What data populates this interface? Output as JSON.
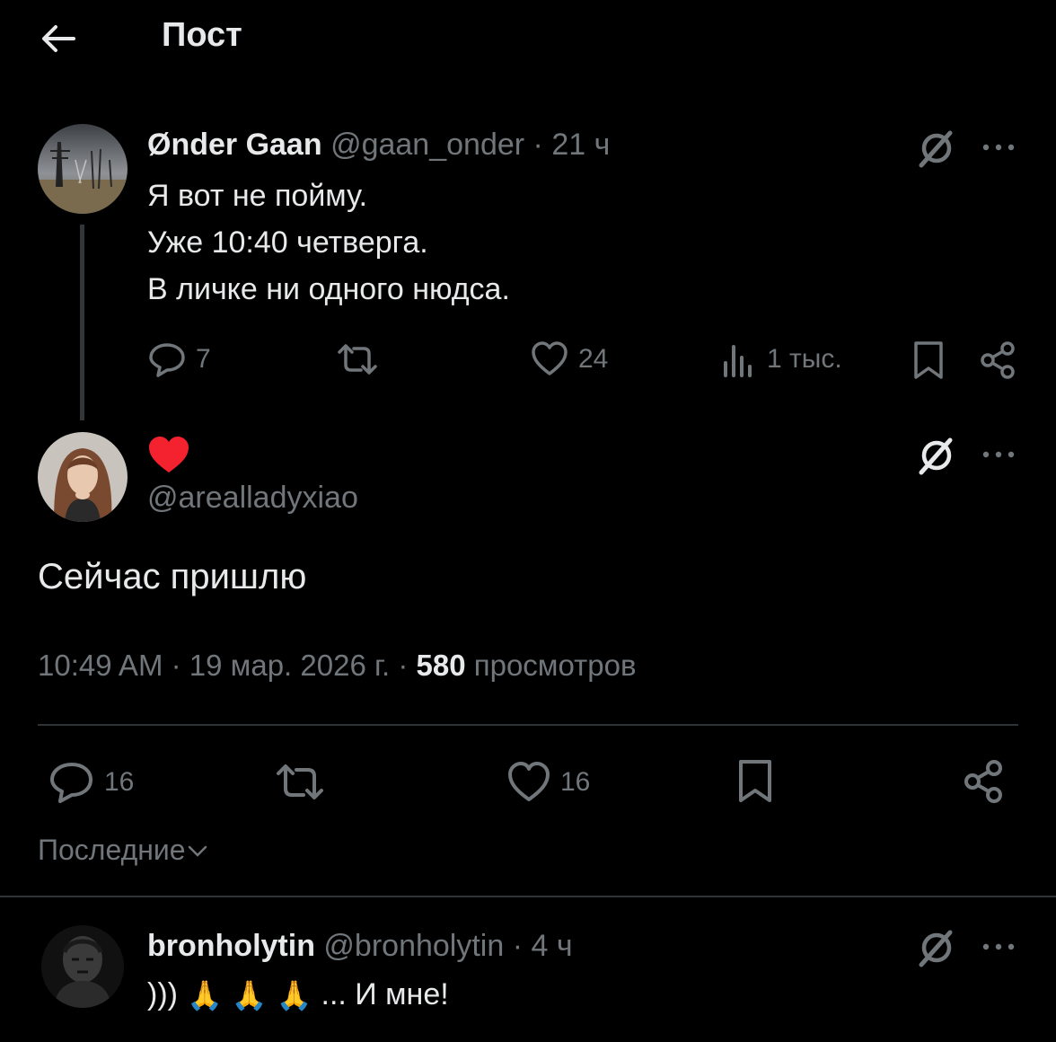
{
  "header": {
    "title": "Пост",
    "back_icon": "arrow-left-icon"
  },
  "parent_post": {
    "author_name": "Ønder Gaan",
    "handle": "@gaan_onder",
    "separator": "·",
    "time": "21 ч",
    "lines": [
      "Я вот не пойму.",
      "Уже 10:40 четверга.",
      "В личке ни одного нюдса."
    ],
    "replies": "7",
    "likes": "24",
    "views": "1 тыс."
  },
  "main_post": {
    "display_name_icon": "red-heart-icon",
    "handle": "@arealladyxiao",
    "text": "Сейчас пришлю",
    "time": "10:49 AM",
    "date": "19 мар. 2026 г.",
    "separator": "·",
    "views_count": "580",
    "views_label": "просмотров",
    "replies": "16",
    "likes": "16"
  },
  "sort": {
    "label": "Последние"
  },
  "reply": {
    "author_name": "bronholytin",
    "handle": "@bronholytin",
    "separator": "·",
    "time": "4 ч",
    "text_start": ")))",
    "emojis": [
      "🙏",
      "🙏",
      "🙏"
    ],
    "text_end": "... И мне!"
  },
  "colors": {
    "background": "#000000",
    "text": "#e7e9ea",
    "muted": "#71767b",
    "divider": "#2f3336",
    "heart": "#f4212e"
  }
}
